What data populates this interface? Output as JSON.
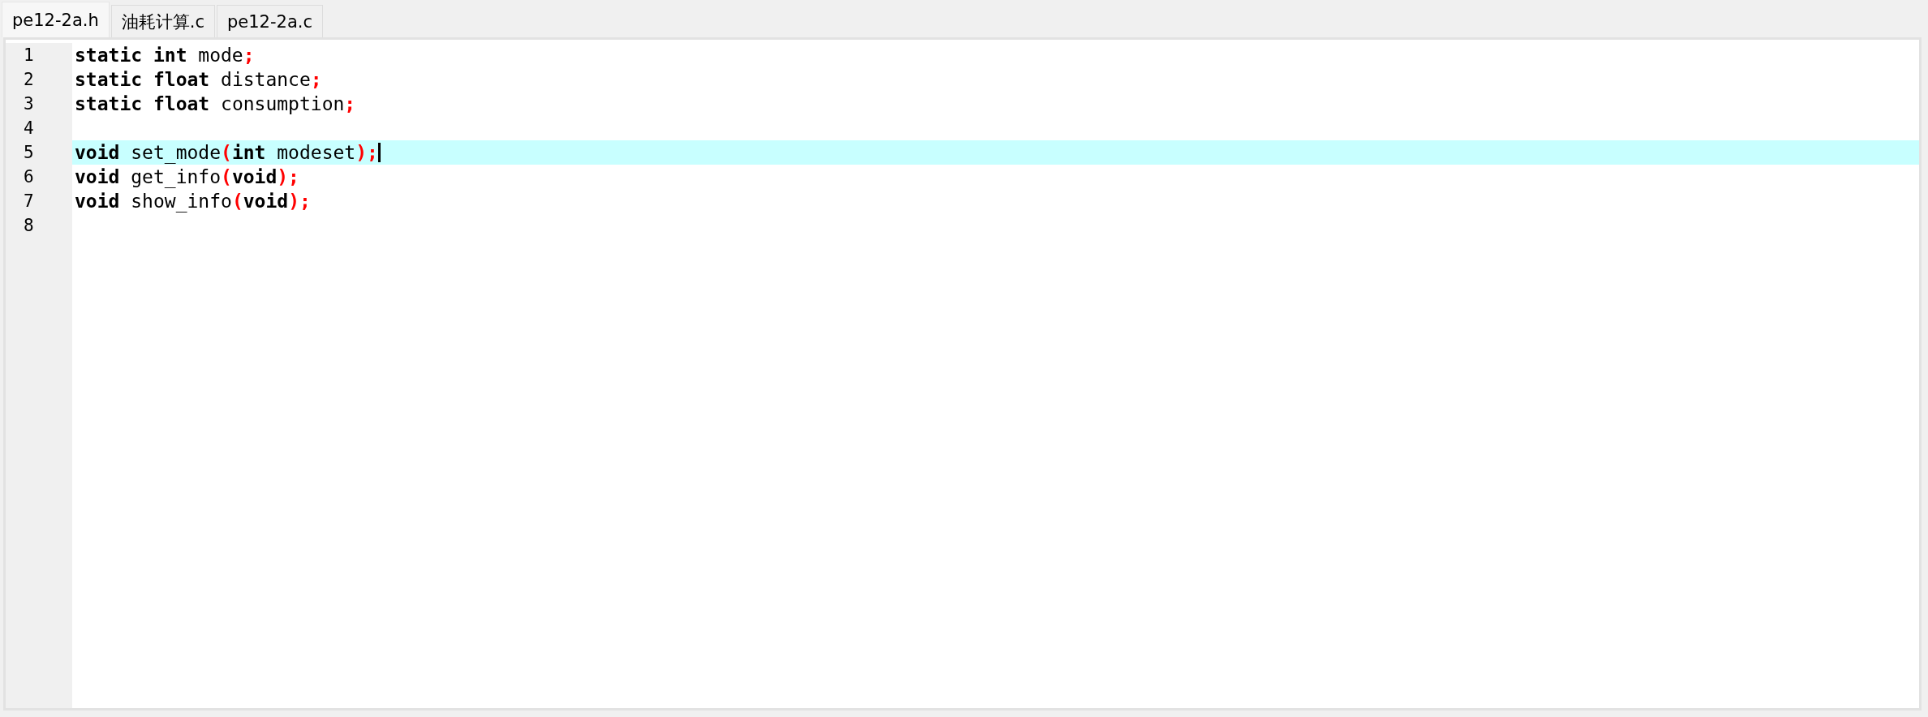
{
  "tabs": [
    {
      "label": "pe12-2a.h",
      "selected": true
    },
    {
      "label": "油耗计算.c",
      "selected": false
    },
    {
      "label": "pe12-2a.c",
      "selected": false
    }
  ],
  "editor": {
    "lines": [
      {
        "number": "1",
        "current": false,
        "tokens": [
          {
            "text": "static",
            "kind": "keyword"
          },
          {
            "text": " int",
            "kind": "keyword"
          },
          {
            "text": " mode",
            "kind": "plain"
          },
          {
            "text": ";",
            "kind": "punct"
          }
        ]
      },
      {
        "number": "2",
        "current": false,
        "tokens": [
          {
            "text": "static",
            "kind": "keyword"
          },
          {
            "text": " float",
            "kind": "keyword"
          },
          {
            "text": " distance",
            "kind": "plain"
          },
          {
            "text": ";",
            "kind": "punct"
          }
        ]
      },
      {
        "number": "3",
        "current": false,
        "tokens": [
          {
            "text": "static",
            "kind": "keyword"
          },
          {
            "text": " float",
            "kind": "keyword"
          },
          {
            "text": " consumption",
            "kind": "plain"
          },
          {
            "text": ";",
            "kind": "punct"
          }
        ]
      },
      {
        "number": "4",
        "current": false
      },
      {
        "number": "5",
        "current": true,
        "tokens": [
          {
            "text": "void",
            "kind": "keyword"
          },
          {
            "text": " set_mode",
            "kind": "plain"
          },
          {
            "text": "(",
            "kind": "punct"
          },
          {
            "text": "int",
            "kind": "keyword"
          },
          {
            "text": " modeset",
            "kind": "plain"
          },
          {
            "text": ");",
            "kind": "punct"
          }
        ]
      },
      {
        "number": "6",
        "current": false,
        "tokens": [
          {
            "text": "void",
            "kind": "keyword"
          },
          {
            "text": " get_info",
            "kind": "plain"
          },
          {
            "text": "(",
            "kind": "punct"
          },
          {
            "text": "void",
            "kind": "keyword"
          },
          {
            "text": ");",
            "kind": "punct"
          }
        ]
      },
      {
        "number": "7",
        "current": false,
        "tokens": [
          {
            "text": "void",
            "kind": "keyword"
          },
          {
            "text": " show_info",
            "kind": "plain"
          },
          {
            "text": "(",
            "kind": "punct"
          },
          {
            "text": "void",
            "kind": "keyword"
          },
          {
            "text": ");",
            "kind": "punct"
          }
        ]
      },
      {
        "number": "8",
        "current": false
      }
    ]
  }
}
